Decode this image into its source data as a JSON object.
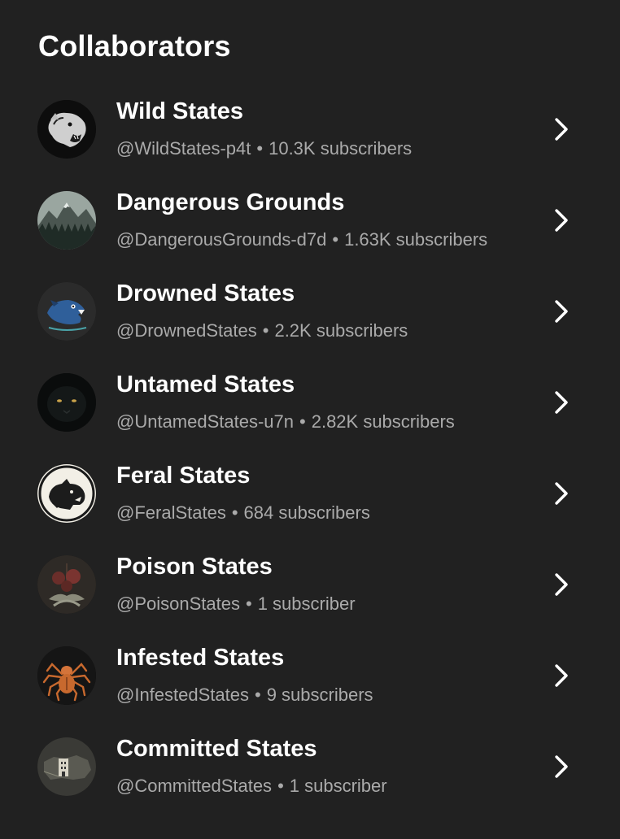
{
  "section": {
    "title": "Collaborators"
  },
  "separator": "•",
  "collaborators": [
    {
      "name": "Wild States",
      "handle": "@WildStates-p4t",
      "subscribers": "10.3K subscribers",
      "avatar_icon": "panther-avatar-icon"
    },
    {
      "name": "Dangerous Grounds",
      "handle": "@DangerousGrounds-d7d",
      "subscribers": "1.63K subscribers",
      "avatar_icon": "mountain-forest-avatar-icon"
    },
    {
      "name": "Drowned States",
      "handle": "@DrownedStates",
      "subscribers": "2.2K subscribers",
      "avatar_icon": "fish-avatar-icon"
    },
    {
      "name": "Untamed States",
      "handle": "@UntamedStates-u7n",
      "subscribers": "2.82K subscribers",
      "avatar_icon": "black-panther-avatar-icon"
    },
    {
      "name": "Feral States",
      "handle": "@FeralStates",
      "subscribers": "684 subscribers",
      "avatar_icon": "feral-hog-avatar-icon"
    },
    {
      "name": "Poison States",
      "handle": "@PoisonStates",
      "subscribers": "1 subscriber",
      "avatar_icon": "poison-plant-avatar-icon"
    },
    {
      "name": "Infested States",
      "handle": "@InfestedStates",
      "subscribers": "9 subscribers",
      "avatar_icon": "spider-avatar-icon"
    },
    {
      "name": "Committed States",
      "handle": "@CommittedStates",
      "subscribers": "1 subscriber",
      "avatar_icon": "asylum-map-avatar-icon"
    }
  ],
  "icons": {
    "row_action": "chevron-right-icon"
  },
  "colors": {
    "background": "#212121",
    "primary_text": "#ffffff",
    "secondary_text": "#aaaaaa"
  }
}
